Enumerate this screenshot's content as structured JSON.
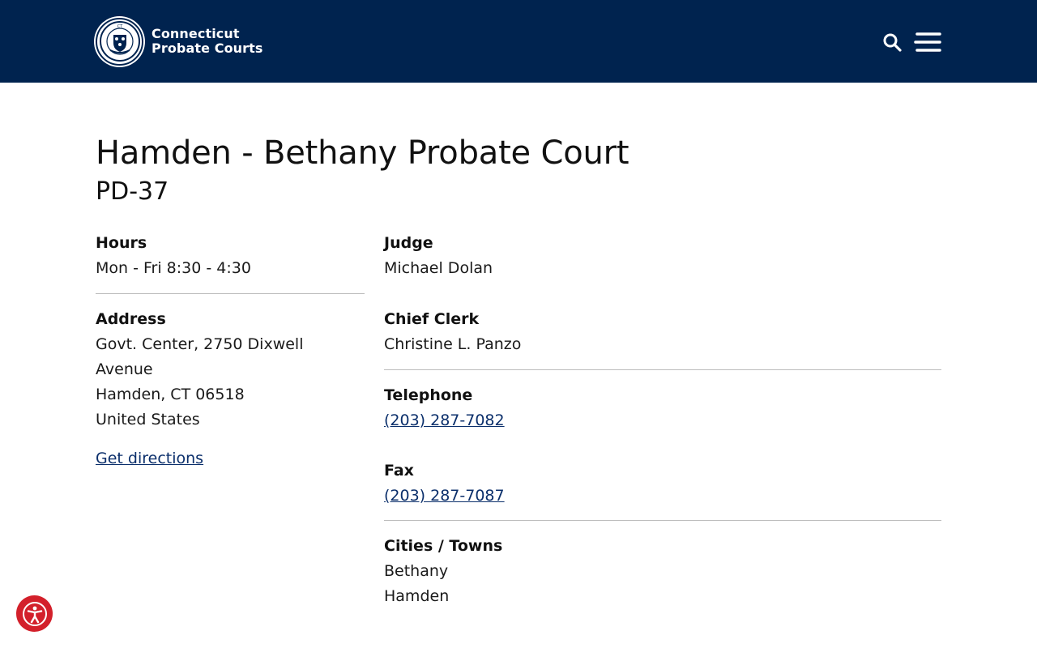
{
  "header": {
    "brand_line1": "Connecticut",
    "brand_line2": "Probate Courts",
    "seal_icon": "connecticut-seal-logo",
    "search_icon": "search-icon",
    "menu_icon": "hamburger-menu-icon",
    "background_color": "#00234f"
  },
  "page": {
    "title": "Hamden - Bethany Probate Court",
    "code": "PD-37"
  },
  "details": {
    "hours_label": "Hours",
    "hours_value": "Mon - Fri 8:30 - 4:30",
    "address_label": "Address",
    "address_line1": "Govt. Center, 2750 Dixwell",
    "address_line2": "Avenue",
    "address_line3": "Hamden, CT 06518",
    "address_line4": "United States",
    "directions_link": "Get directions",
    "judge_label": "Judge",
    "judge_value": "Michael Dolan",
    "clerk_label": "Chief Clerk",
    "clerk_value": "Christine L. Panzo",
    "telephone_label": "Telephone",
    "telephone_value": "(203) 287-7082",
    "fax_label": "Fax",
    "fax_value": "(203) 287-7087",
    "towns_label": "Cities / Towns",
    "towns": [
      "Bethany",
      "Hamden"
    ]
  },
  "accessibility": {
    "icon": "accessibility-icon",
    "color": "#d3202b"
  },
  "link_color": "#0b2f6b"
}
